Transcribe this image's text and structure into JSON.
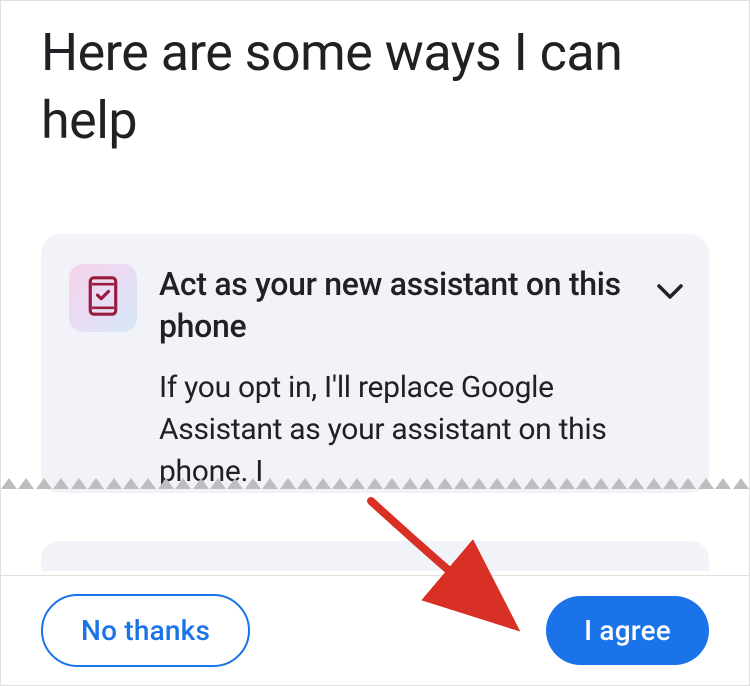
{
  "header": {
    "title": "Here are some ways I can help"
  },
  "card": {
    "title": "Act as your new assistant on this phone",
    "description": "If you opt in, I'll replace Google Assistant as your assistant on this phone. I",
    "icon_name": "phone-check-icon"
  },
  "actions": {
    "decline_label": "No thanks",
    "accept_label": "I agree"
  },
  "colors": {
    "primary": "#1a73e8",
    "text": "#202124",
    "card_bg": "#f1f3f8",
    "icon_accent": "#991b3d"
  }
}
